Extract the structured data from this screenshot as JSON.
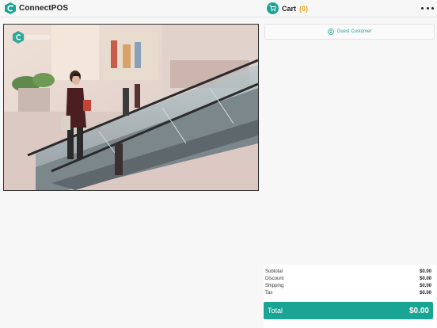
{
  "header": {
    "brand_name": "ConnectPOS",
    "cart_label": "Cart",
    "cart_count": "(0)",
    "more_icon": "more-dots-icon",
    "logo_icon": "connectpos-logo-icon",
    "cart_icon": "cart-icon"
  },
  "banner": {
    "watermark_icon": "connectpos-logo-icon",
    "description_icon": "shopping-mall-photo"
  },
  "cart": {
    "customer_label": "Guest Customer",
    "customer_icon": "user-circle-icon"
  },
  "summary": {
    "rows": [
      {
        "label": "Subtotal",
        "value": "$0.00"
      },
      {
        "label": "Discount",
        "value": "$0.00"
      },
      {
        "label": "Shipping",
        "value": "$0.00"
      },
      {
        "label": "Tax",
        "value": "$0.00"
      }
    ],
    "total_label": "Total",
    "total_value": "$0.00"
  },
  "colors": {
    "accent": "#1aa493",
    "count": "#f0a21a"
  }
}
